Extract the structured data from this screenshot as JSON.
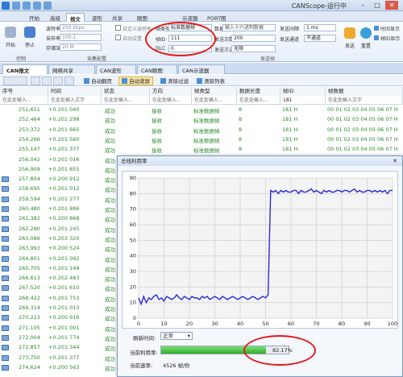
{
  "app": {
    "title": "CANScope-运行中"
  },
  "menu": {
    "tabs": [
      "开始",
      "高级",
      "报文",
      "波形",
      "共享",
      "眼图",
      "示波器",
      "PORT图"
    ],
    "active_index": 2
  },
  "ribbon": {
    "start_label": "开始",
    "stop_label": "停止",
    "reset_label": "重置",
    "baud_label": "波特率",
    "baud_value": "250 kbps",
    "sample_label": "采样率",
    "sample_value": "100:1",
    "store_label": "存储深度",
    "store_value": "20 M",
    "check1": "自定义波特率",
    "check2": "自动设置",
    "frame_type_label": "帧类型",
    "frame_type_value": "标准数据帧",
    "id_label": "帧ID",
    "id_value": "111",
    "dlc_label": "DLC",
    "dlc_value": "0",
    "data_label": "数据",
    "data_value": "输入十六进制数据",
    "count_label": "发送次数",
    "count_value": "200",
    "mode_label": "发送方式",
    "mode_value": "无限",
    "interval_label": "发送间隔",
    "interval_value": "1 ms",
    "channel_label": "发送通道",
    "channel_value": "不通道",
    "right_opt1": "时间显示",
    "right_opt2": "帧ID显示",
    "grp_control": "控制",
    "grp_collect": "采集配置",
    "grp_send": "发送帧",
    "send_label": "发送"
  },
  "doc_tabs": [
    "CAN报文",
    "网络共享",
    "CAN波形",
    "CAN眼图",
    "CAN示波器"
  ],
  "toolbar": {
    "auto_scroll": "自动翻页",
    "auto_save": "自动滚屏",
    "clear_filter": "清除过滤",
    "clear_list": "清除列表"
  },
  "table": {
    "headers": [
      "序号",
      "时间",
      "状态",
      "方向",
      "帧类型",
      "数据长度",
      "帧ID",
      "帧数据"
    ],
    "filter_placeholder": "在此处输入...",
    "filter_text": "在此处输入文字",
    "filter_id": "181",
    "rows": [
      [
        "251,651",
        "+0.201 040",
        "成功",
        "接收",
        "标准数据帧",
        "8",
        "181 H",
        "00 01 02 03 04 05 06 07 H"
      ],
      [
        "252,464",
        "+0.201 298",
        "成功",
        "接收",
        "标准数据帧",
        "8",
        "181 H",
        "00 01 02 03 04 05 06 07 H"
      ],
      [
        "253,372",
        "+0.201 665",
        "成功",
        "接收",
        "标准数据帧",
        "8",
        "181 H",
        "00 01 02 03 04 05 06 07 H"
      ],
      [
        "254,266",
        "+0.201 560",
        "成功",
        "接收",
        "标准数据帧",
        "8",
        "181 H",
        "00 01 02 03 04 05 06 07 H"
      ],
      [
        "255,147",
        "+0.201 377",
        "成功",
        "接收",
        "标准数据帧",
        "8",
        "181 H",
        "00 01 02 03 04 05 06 07 H"
      ],
      [
        "256,042",
        "+0.201 016",
        "成功",
        "接收",
        "标准数据帧",
        "8",
        "181 H",
        "00 01 02 03 04 05 06 07 H"
      ],
      [
        "256,909",
        "+0.201 855",
        "成功",
        "",
        "",
        "",
        "",
        ""
      ],
      [
        "257,804",
        "+0.200 912",
        "成功",
        "",
        "",
        "",
        "",
        ""
      ],
      [
        "258,695",
        "+0.201 012",
        "成功",
        "",
        "",
        "",
        "",
        ""
      ],
      [
        "259,594",
        "+0.201 277",
        "成功",
        "",
        "",
        "",
        "",
        ""
      ],
      [
        "260,480",
        "+0.201 886",
        "成功",
        "",
        "",
        "",
        "",
        ""
      ],
      [
        "261,382",
        "+0.200 868",
        "成功",
        "",
        "",
        "",
        "",
        ""
      ],
      [
        "262,280",
        "+0.201 245",
        "成功",
        "",
        "",
        "",
        "",
        ""
      ],
      [
        "263,086",
        "+0.203 320",
        "成功",
        "",
        "",
        "",
        "",
        ""
      ],
      [
        "263,993",
        "+0.200 524",
        "成功",
        "",
        "",
        "",
        "",
        ""
      ],
      [
        "264,801",
        "+0.201 092",
        "成功",
        "",
        "",
        "",
        "",
        ""
      ],
      [
        "265,705",
        "+0.201 149",
        "成功",
        "",
        "",
        "",
        "",
        ""
      ],
      [
        "266,613",
        "+0.202 483",
        "成功",
        "",
        "",
        "",
        "",
        ""
      ],
      [
        "267,520",
        "+0.201 610",
        "成功",
        "",
        "",
        "",
        "",
        ""
      ],
      [
        "268,422",
        "+0.201 753",
        "成功",
        "",
        "",
        "",
        "",
        ""
      ],
      [
        "269,314",
        "+0.201 013",
        "成功",
        "",
        "",
        "",
        "",
        ""
      ],
      [
        "270,223",
        "+0.200 916",
        "成功",
        "",
        "",
        "",
        "",
        ""
      ],
      [
        "271,105",
        "+0.201 001",
        "成功",
        "",
        "",
        "",
        "",
        ""
      ],
      [
        "272,004",
        "+0.201 774",
        "成功",
        "",
        "",
        "",
        "",
        ""
      ],
      [
        "272,857",
        "+0.201 344",
        "成功",
        "",
        "",
        "",
        "",
        ""
      ],
      [
        "273,750",
        "+0.201 377",
        "成功",
        "",
        "",
        "",
        "",
        ""
      ],
      [
        "274,624",
        "+0.200 563",
        "成功",
        "",
        "",
        "",
        "",
        ""
      ]
    ]
  },
  "dialog": {
    "title": "总线利用率",
    "refresh_label": "刷新时间:",
    "refresh_value": "正常",
    "util_label": "当前利用率:",
    "util_value": "82.17%",
    "util_fraction": 0.8217,
    "rate_label": "当前速率:",
    "rate_value": "4526 帧/秒"
  },
  "chart_data": {
    "type": "line",
    "xlim": [
      0,
      100
    ],
    "ylim": [
      0,
      90
    ],
    "xticks": [
      "0",
      "10",
      "20",
      "30",
      "40",
      "50",
      "60",
      "70",
      "80",
      "90",
      "100"
    ],
    "yticks": [
      "0",
      "10",
      "20",
      "30",
      "40",
      "50",
      "60",
      "70",
      "80",
      "90"
    ],
    "grid": true,
    "series": [
      {
        "color": "#2a2ad8",
        "x": [
          0,
          1,
          2,
          3,
          4,
          5,
          6,
          7,
          8,
          9,
          10,
          11,
          12,
          13,
          14,
          15,
          16,
          17,
          18,
          19,
          20,
          21,
          22,
          23,
          24,
          25,
          26,
          27,
          28,
          29,
          30,
          31,
          32,
          33,
          34,
          35,
          36,
          37,
          38,
          39,
          40,
          41,
          42,
          43,
          44,
          45,
          46,
          47,
          48,
          49,
          50,
          51,
          52,
          53,
          54,
          55,
          56,
          57,
          58,
          59,
          60,
          61,
          62,
          63,
          64,
          65,
          66,
          67,
          68,
          69,
          70,
          71,
          72,
          73,
          74,
          75,
          76,
          77,
          78,
          79,
          80,
          81,
          82,
          83,
          84,
          85,
          86,
          87,
          88,
          89,
          90,
          91,
          92,
          93,
          94,
          95,
          96,
          97,
          98,
          99,
          100
        ],
        "y": [
          13,
          9,
          14,
          10,
          13,
          12,
          14,
          15,
          12,
          13,
          11,
          14,
          13,
          12,
          13,
          15,
          13,
          12,
          14,
          13,
          12,
          14,
          13,
          13,
          12,
          14,
          13,
          14,
          12,
          13,
          14,
          13,
          12,
          14,
          13,
          12,
          13,
          14,
          13,
          12,
          13,
          14,
          13,
          12,
          13,
          14,
          13,
          12,
          13,
          14,
          13,
          15,
          82,
          81,
          82,
          80,
          82,
          81,
          82,
          81,
          81,
          82,
          82,
          80,
          82,
          81,
          81,
          82,
          83,
          81,
          82,
          81,
          80,
          82,
          81,
          82,
          81,
          81,
          82,
          82,
          81,
          82,
          82,
          81,
          82,
          83,
          81,
          82,
          81,
          81,
          82,
          82,
          81,
          82,
          81,
          82,
          81,
          82,
          80,
          82,
          82
        ]
      }
    ]
  }
}
